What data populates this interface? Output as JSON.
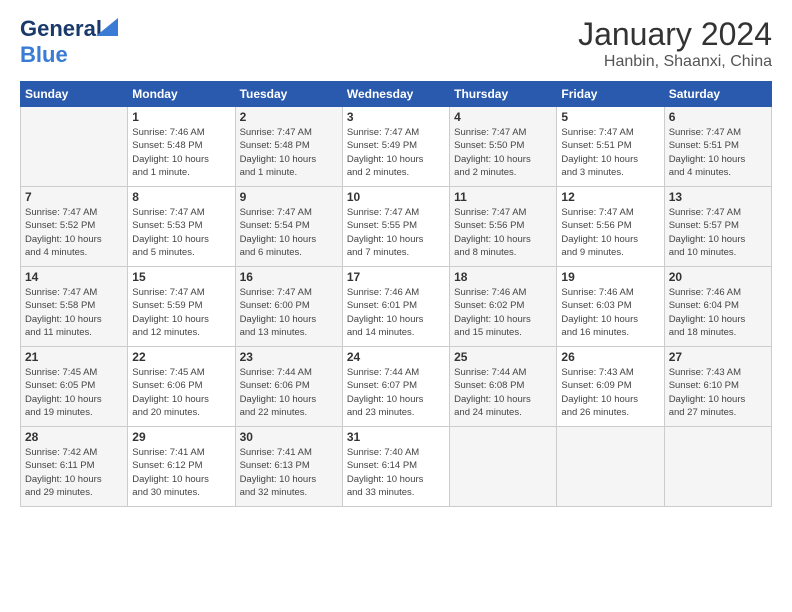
{
  "header": {
    "logo_line1": "General",
    "logo_line2": "Blue",
    "month": "January 2024",
    "location": "Hanbin, Shaanxi, China"
  },
  "weekdays": [
    "Sunday",
    "Monday",
    "Tuesday",
    "Wednesday",
    "Thursday",
    "Friday",
    "Saturday"
  ],
  "weeks": [
    [
      {
        "day": "",
        "info": ""
      },
      {
        "day": "1",
        "info": "Sunrise: 7:46 AM\nSunset: 5:48 PM\nDaylight: 10 hours\nand 1 minute."
      },
      {
        "day": "2",
        "info": "Sunrise: 7:47 AM\nSunset: 5:48 PM\nDaylight: 10 hours\nand 1 minute."
      },
      {
        "day": "3",
        "info": "Sunrise: 7:47 AM\nSunset: 5:49 PM\nDaylight: 10 hours\nand 2 minutes."
      },
      {
        "day": "4",
        "info": "Sunrise: 7:47 AM\nSunset: 5:50 PM\nDaylight: 10 hours\nand 2 minutes."
      },
      {
        "day": "5",
        "info": "Sunrise: 7:47 AM\nSunset: 5:51 PM\nDaylight: 10 hours\nand 3 minutes."
      },
      {
        "day": "6",
        "info": "Sunrise: 7:47 AM\nSunset: 5:51 PM\nDaylight: 10 hours\nand 4 minutes."
      }
    ],
    [
      {
        "day": "7",
        "info": "Sunrise: 7:47 AM\nSunset: 5:52 PM\nDaylight: 10 hours\nand 4 minutes."
      },
      {
        "day": "8",
        "info": "Sunrise: 7:47 AM\nSunset: 5:53 PM\nDaylight: 10 hours\nand 5 minutes."
      },
      {
        "day": "9",
        "info": "Sunrise: 7:47 AM\nSunset: 5:54 PM\nDaylight: 10 hours\nand 6 minutes."
      },
      {
        "day": "10",
        "info": "Sunrise: 7:47 AM\nSunset: 5:55 PM\nDaylight: 10 hours\nand 7 minutes."
      },
      {
        "day": "11",
        "info": "Sunrise: 7:47 AM\nSunset: 5:56 PM\nDaylight: 10 hours\nand 8 minutes."
      },
      {
        "day": "12",
        "info": "Sunrise: 7:47 AM\nSunset: 5:56 PM\nDaylight: 10 hours\nand 9 minutes."
      },
      {
        "day": "13",
        "info": "Sunrise: 7:47 AM\nSunset: 5:57 PM\nDaylight: 10 hours\nand 10 minutes."
      }
    ],
    [
      {
        "day": "14",
        "info": "Sunrise: 7:47 AM\nSunset: 5:58 PM\nDaylight: 10 hours\nand 11 minutes."
      },
      {
        "day": "15",
        "info": "Sunrise: 7:47 AM\nSunset: 5:59 PM\nDaylight: 10 hours\nand 12 minutes."
      },
      {
        "day": "16",
        "info": "Sunrise: 7:47 AM\nSunset: 6:00 PM\nDaylight: 10 hours\nand 13 minutes."
      },
      {
        "day": "17",
        "info": "Sunrise: 7:46 AM\nSunset: 6:01 PM\nDaylight: 10 hours\nand 14 minutes."
      },
      {
        "day": "18",
        "info": "Sunrise: 7:46 AM\nSunset: 6:02 PM\nDaylight: 10 hours\nand 15 minutes."
      },
      {
        "day": "19",
        "info": "Sunrise: 7:46 AM\nSunset: 6:03 PM\nDaylight: 10 hours\nand 16 minutes."
      },
      {
        "day": "20",
        "info": "Sunrise: 7:46 AM\nSunset: 6:04 PM\nDaylight: 10 hours\nand 18 minutes."
      }
    ],
    [
      {
        "day": "21",
        "info": "Sunrise: 7:45 AM\nSunset: 6:05 PM\nDaylight: 10 hours\nand 19 minutes."
      },
      {
        "day": "22",
        "info": "Sunrise: 7:45 AM\nSunset: 6:06 PM\nDaylight: 10 hours\nand 20 minutes."
      },
      {
        "day": "23",
        "info": "Sunrise: 7:44 AM\nSunset: 6:06 PM\nDaylight: 10 hours\nand 22 minutes."
      },
      {
        "day": "24",
        "info": "Sunrise: 7:44 AM\nSunset: 6:07 PM\nDaylight: 10 hours\nand 23 minutes."
      },
      {
        "day": "25",
        "info": "Sunrise: 7:44 AM\nSunset: 6:08 PM\nDaylight: 10 hours\nand 24 minutes."
      },
      {
        "day": "26",
        "info": "Sunrise: 7:43 AM\nSunset: 6:09 PM\nDaylight: 10 hours\nand 26 minutes."
      },
      {
        "day": "27",
        "info": "Sunrise: 7:43 AM\nSunset: 6:10 PM\nDaylight: 10 hours\nand 27 minutes."
      }
    ],
    [
      {
        "day": "28",
        "info": "Sunrise: 7:42 AM\nSunset: 6:11 PM\nDaylight: 10 hours\nand 29 minutes."
      },
      {
        "day": "29",
        "info": "Sunrise: 7:41 AM\nSunset: 6:12 PM\nDaylight: 10 hours\nand 30 minutes."
      },
      {
        "day": "30",
        "info": "Sunrise: 7:41 AM\nSunset: 6:13 PM\nDaylight: 10 hours\nand 32 minutes."
      },
      {
        "day": "31",
        "info": "Sunrise: 7:40 AM\nSunset: 6:14 PM\nDaylight: 10 hours\nand 33 minutes."
      },
      {
        "day": "",
        "info": ""
      },
      {
        "day": "",
        "info": ""
      },
      {
        "day": "",
        "info": ""
      }
    ]
  ]
}
